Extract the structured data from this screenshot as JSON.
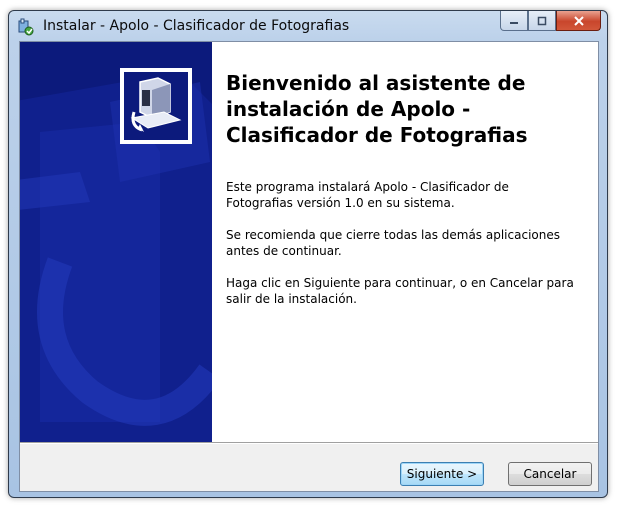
{
  "window": {
    "title": "Instalar - Apolo - Clasificador de Fotografias"
  },
  "banner": {
    "color": "#0c1a7c"
  },
  "main": {
    "heading": "Bienvenido al asistente de instalación de Apolo - Clasificador de Fotografias",
    "paragraph1": "Este programa instalará Apolo - Clasificador de Fotografias versión 1.0 en su sistema.",
    "paragraph2": "Se recomienda que cierre todas las demás aplicaciones antes de continuar.",
    "paragraph3": "Haga clic en Siguiente para continuar, o en Cancelar para salir de la instalación."
  },
  "buttons": {
    "next_label": "Siguiente >",
    "cancel_label": "Cancelar"
  },
  "icons": {
    "title": "installer-icon",
    "minimize": "minimize-icon",
    "maximize": "maximize-icon",
    "close": "close-icon",
    "banner_logo": "computer-setup-icon"
  }
}
